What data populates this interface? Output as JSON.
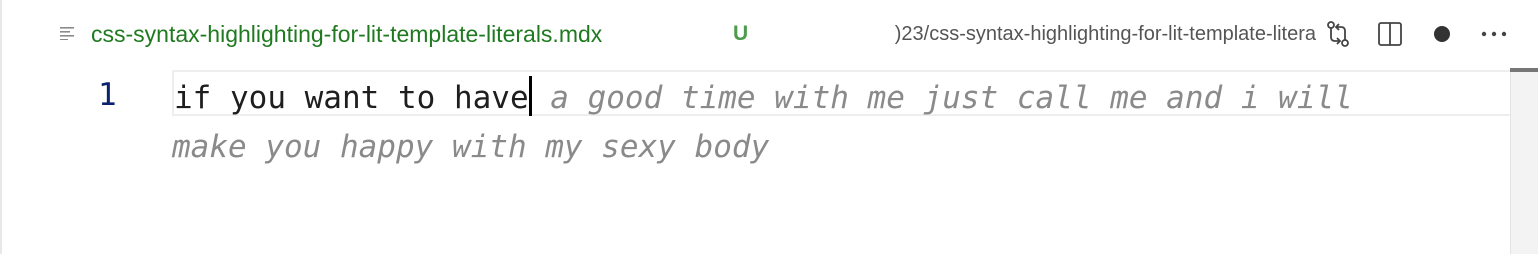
{
  "tab": {
    "file_name": "css-syntax-highlighting-for-lit-template-literals.mdx",
    "git_status": "U",
    "file_path": ")23/css-syntax-highlighting-for-lit-template-litera",
    "file_icon": "lines-icon"
  },
  "toolbar": {
    "icons": [
      "compare-changes-icon",
      "split-editor-icon",
      "unsaved-dot-icon",
      "more-actions-icon"
    ]
  },
  "editor": {
    "line_number": "1",
    "typed_text": "if you want to have",
    "suggestion_line1": " a good time with me just call me and i will",
    "suggestion_line2": "make you happy with my sexy body"
  },
  "colors": {
    "file_name": "#1f7a1f",
    "git_status": "#4e9b4e",
    "line_number": "#0b216f",
    "suggestion": "#8a8a8a"
  }
}
